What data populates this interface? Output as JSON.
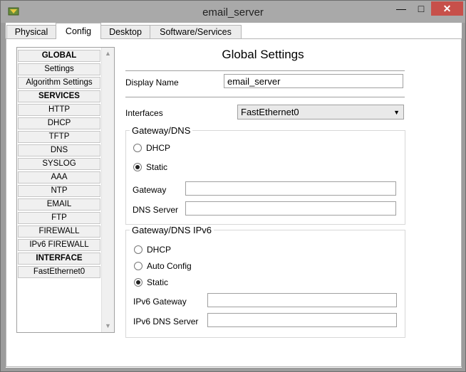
{
  "window": {
    "title": "email_server",
    "minimize": "—",
    "maximize": "□",
    "close": "✕",
    "icon": "packet-tracer-icon"
  },
  "tabs": [
    "Physical",
    "Config",
    "Desktop",
    "Software/Services"
  ],
  "active_tab": "Config",
  "sidebar": {
    "items": [
      {
        "label": "GLOBAL",
        "header": true
      },
      {
        "label": "Settings",
        "header": false
      },
      {
        "label": "Algorithm Settings",
        "header": false
      },
      {
        "label": "SERVICES",
        "header": true
      },
      {
        "label": "HTTP",
        "header": false
      },
      {
        "label": "DHCP",
        "header": false
      },
      {
        "label": "TFTP",
        "header": false
      },
      {
        "label": "DNS",
        "header": false
      },
      {
        "label": "SYSLOG",
        "header": false
      },
      {
        "label": "AAA",
        "header": false
      },
      {
        "label": "NTP",
        "header": false
      },
      {
        "label": "EMAIL",
        "header": false
      },
      {
        "label": "FTP",
        "header": false
      },
      {
        "label": "FIREWALL",
        "header": false
      },
      {
        "label": "IPv6 FIREWALL",
        "header": false
      },
      {
        "label": "INTERFACE",
        "header": true
      },
      {
        "label": "FastEthernet0",
        "header": false
      }
    ]
  },
  "main": {
    "heading": "Global Settings",
    "display_name_label": "Display Name",
    "display_name_value": "email_server",
    "interfaces_label": "Interfaces",
    "interfaces_value": "FastEthernet0",
    "gateway_dns": {
      "title": "Gateway/DNS",
      "dhcp_label": "DHCP",
      "static_label": "Static",
      "selected": "Static",
      "gateway_label": "Gateway",
      "gateway_value": "",
      "dns_label": "DNS Server",
      "dns_value": ""
    },
    "gateway_dns_ipv6": {
      "title": "Gateway/DNS IPv6",
      "dhcp_label": "DHCP",
      "auto_label": "Auto Config",
      "static_label": "Static",
      "selected": "Static",
      "gateway_label": "IPv6 Gateway",
      "gateway_value": "",
      "dns_label": "IPv6 DNS Server",
      "dns_value": ""
    }
  }
}
